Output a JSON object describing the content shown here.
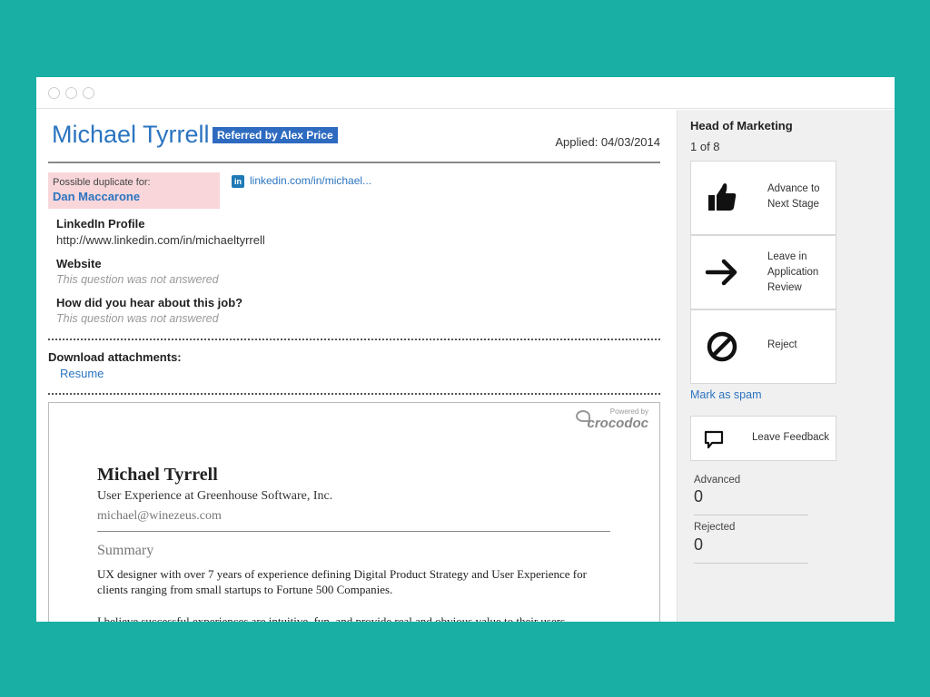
{
  "candidate": {
    "name": "Michael Tyrrell",
    "referral_badge": "Referred by Alex Price",
    "applied": "Applied: 04/03/2014"
  },
  "duplicate": {
    "label": "Possible duplicate for:",
    "name": "Dan Maccarone"
  },
  "linkedin_link": {
    "icon_text": "in",
    "text": "linkedin.com/in/michael..."
  },
  "questions": [
    {
      "title": "LinkedIn Profile",
      "answer": "http://www.linkedin.com/in/michaeltyrrell"
    },
    {
      "title": "Website",
      "answer": "This question was not answered"
    },
    {
      "title": "How did you hear about this job?",
      "answer": "This question was not answered"
    }
  ],
  "attachments": {
    "title": "Download attachments:",
    "items": [
      "Resume"
    ]
  },
  "viewer": {
    "powered_by": "Powered by",
    "brand": "crocodoc"
  },
  "resume_doc": {
    "name": "Michael Tyrrell",
    "title": "User Experience at Greenhouse Software, Inc.",
    "email": "michael@winezeus.com",
    "section": "Summary",
    "paragraph1": "UX designer with over 7 years of experience defining Digital Product Strategy and User Experience for clients ranging from small startups to Fortune 500 Companies.",
    "paragraph2": "I believe successful experiences are intuitive, fun, and provide real and obvious value to their users."
  },
  "sidebar": {
    "job_title": "Head of Marketing",
    "position": "1 of 8",
    "actions": [
      {
        "label": "Advance to Next Stage",
        "icon": "thumbs-up-icon"
      },
      {
        "label": "Leave in Application Review",
        "icon": "arrow-right-icon"
      },
      {
        "label": "Reject",
        "icon": "prohibited-icon"
      }
    ],
    "spam": "Mark as spam",
    "feedback": {
      "label": "Leave Feedback",
      "icon": "speech-bubble-icon"
    },
    "stats": [
      {
        "label": "Advanced",
        "value": "0"
      },
      {
        "label": "Rejected",
        "value": "0"
      }
    ]
  },
  "colors": {
    "background": "#1aafa4",
    "link": "#2b74c0",
    "badge": "#2e6bc0",
    "duplicate_bg": "#f8d6da",
    "sidebar_bg": "#f0f0f0"
  }
}
